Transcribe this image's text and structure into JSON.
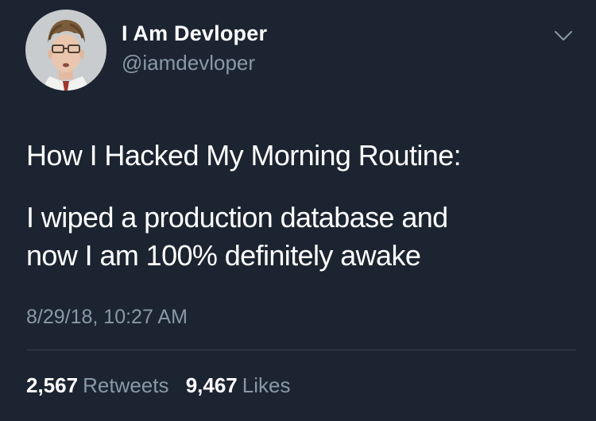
{
  "author": {
    "display_name": "I Am Devloper",
    "handle": "@iamdevloper"
  },
  "tweet": {
    "lines": [
      "How I Hacked My Morning Routine:",
      "I wiped a production database and",
      "now I am 100% definitely awake"
    ],
    "timestamp": "8/29/18, 10:27 AM"
  },
  "stats": {
    "retweets_count": "2,567",
    "retweets_label": "Retweets",
    "likes_count": "9,467",
    "likes_label": "Likes"
  },
  "icons": {
    "menu": "chevron-down-icon"
  },
  "colors": {
    "background": "#1c2431",
    "primary_text": "#ffffff",
    "secondary_text": "#8899a6",
    "divider": "#38444d"
  }
}
